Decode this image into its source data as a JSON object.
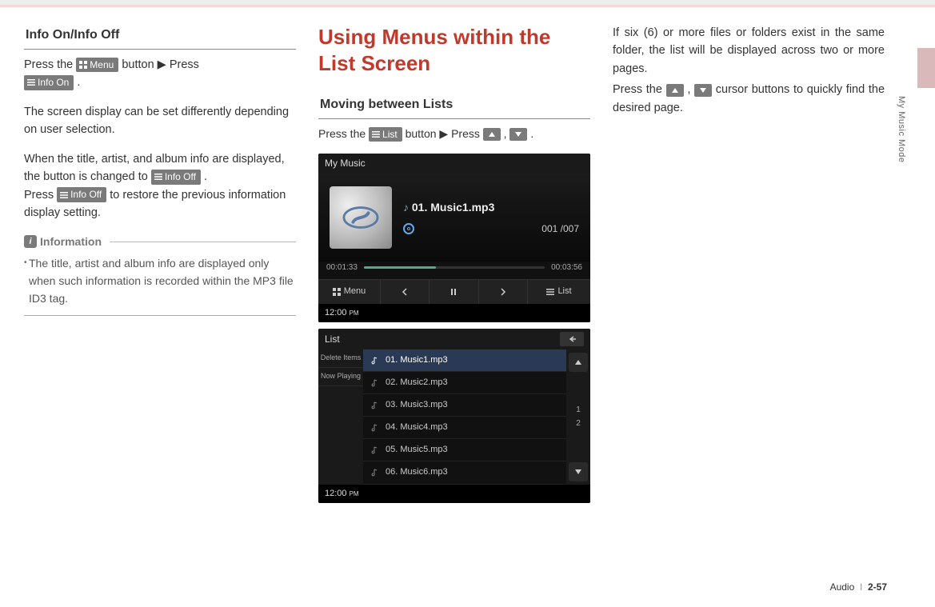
{
  "side_label": "My Music Mode",
  "footer": {
    "section": "Audio",
    "sep": "I",
    "page": "2-57"
  },
  "col1": {
    "heading": "Info On/Info Off",
    "line1_a": "Press the ",
    "btn_menu": "Menu",
    "line1_b": " button ▶ Press",
    "btn_info_on": "Info On",
    "line1_c": " .",
    "para2": "The screen display can be set differently depending on user selection.",
    "para3_a": "When the title, artist, and album info are displayed, the button is changed to ",
    "btn_info_off": "Info Off",
    "para3_b": " .",
    "para4_a": "Press ",
    "para4_b": " to restore the previous information display setting.",
    "info_label": "Information",
    "bullet": "The title, artist and album info are displayed only when such information is recorded within the MP3 file ID3 tag."
  },
  "col2": {
    "big_heading": "Using Menus within the List Screen",
    "heading": "Moving between Lists",
    "line_a": "Press the ",
    "btn_list": "List",
    "line_b": " button ▶ Press ",
    "line_c": " , ",
    "line_d": " .",
    "shot1": {
      "title": "My Music",
      "track": "01. Music1.mp3",
      "counter": "001 /007",
      "t_elapsed": "00:01:33",
      "t_total": "00:03:56",
      "menu_label": "Menu",
      "list_label": "List",
      "clock": "12:00",
      "clock_suffix": "PM"
    },
    "shot2": {
      "title": "List",
      "side_delete": "Delete Items",
      "side_now": "Now Playing",
      "rows": [
        "01. Music1.mp3",
        "02. Music2.mp3",
        "03. Music3.mp3",
        "04. Music4.mp3",
        "05. Music5.mp3",
        "06. Music6.mp3"
      ],
      "page_cur": "1",
      "page_tot": "2",
      "clock": "12:00",
      "clock_suffix": "PM"
    }
  },
  "col3": {
    "para1": "If six (6) or more files or folders exist in the same folder, the list will be displayed across two or more pages.",
    "para2_a": "Press the ",
    "para2_b": " , ",
    "para2_c": " cursor buttons to quickly find the desired page."
  }
}
